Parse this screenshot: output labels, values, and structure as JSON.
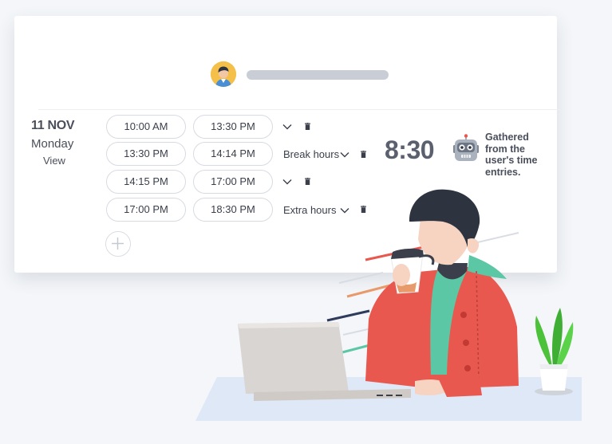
{
  "entry": {
    "date": "11 NOV",
    "weekday": "Monday",
    "view_label": "View"
  },
  "rows": [
    {
      "start": "10:00 AM",
      "end": "13:30 PM",
      "label": ""
    },
    {
      "start": "13:30 PM",
      "end": "14:14 PM",
      "label": "Break hours"
    },
    {
      "start": "14:15 PM",
      "end": "17:00 PM",
      "label": ""
    },
    {
      "start": "17:00 PM",
      "end": "18:30 PM",
      "label": "Extra hours"
    }
  ],
  "summary": {
    "total": "8:30",
    "note": "Gathered from the user's time entries."
  },
  "icons": {
    "avatar": "user-avatar",
    "dropdown": "chevron-down-icon",
    "delete": "trash-icon",
    "add": "plus-icon",
    "bot": "robot-icon"
  },
  "colors": {
    "card": "#ffffff",
    "pill_border": "#d7dbe2",
    "text": "#3a3f4b",
    "avatar_bg": "#f5c04a",
    "jacket": "#e8584f",
    "hoodie": "#5cc7a4",
    "plant": "#4cc13a"
  }
}
